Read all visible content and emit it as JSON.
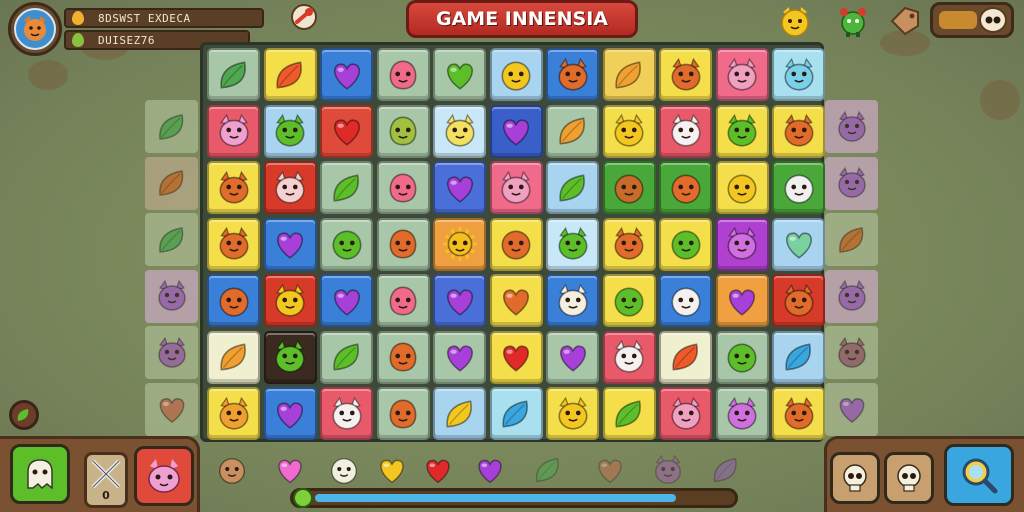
{
  "hud": {
    "stat1_text": "8DSWST EXDECA",
    "stat2_text": "DUISEZ76",
    "stat1_icon": "drop-icon",
    "stat2_icon": "leaf-icon",
    "title": "GAME INNENSIA",
    "sound_toggle_on": true
  },
  "colors": {
    "title_bg": "#c8362c",
    "accent_green": "#5cbf2a",
    "accent_blue": "#3aa6e0"
  },
  "board": {
    "rows": [
      [
        [
          "#a8c7a8",
          "leaf",
          "#4fa84f"
        ],
        [
          "#f4df4a",
          "leaf",
          "#ef5a2a"
        ],
        [
          "#3a7fd8",
          "heart",
          "#a740d8"
        ],
        [
          "#a8c7a8",
          "blob",
          "#f06a8a"
        ],
        [
          "#a8c7a8",
          "heart",
          "#5cbf2a"
        ],
        [
          "#a8d4f0",
          "face",
          "#f3c620"
        ],
        [
          "#3a7fd8",
          "cat",
          "#e06b2a"
        ],
        [
          "#f0d058",
          "leaf",
          "#f0a030"
        ],
        [
          "#f4df4a",
          "cat",
          "#e06b2a"
        ],
        [
          "#f06a8a",
          "cat",
          "#f0a0c0"
        ],
        [
          "#a8e0f0",
          "cat",
          "#7ad0e8"
        ]
      ],
      [
        [
          "#e85a6a",
          "cat",
          "#f0a0d0"
        ],
        [
          "#a8d4f0",
          "cat",
          "#5cbf2a"
        ],
        [
          "#e04a3a",
          "heart",
          "#e02a2a"
        ],
        [
          "#a8c7a8",
          "blob",
          "#a0c040"
        ],
        [
          "#c8e8f8",
          "cat",
          "#f4e060"
        ],
        [
          "#3a5fc8",
          "heart",
          "#a740d8"
        ],
        [
          "#a8c7a8",
          "leaf",
          "#f0a030"
        ],
        [
          "#f4df4a",
          "cat",
          "#f3c620"
        ],
        [
          "#e85a6a",
          "cat",
          "#f6f0f0"
        ],
        [
          "#f4df4a",
          "cat",
          "#5cbf2a"
        ],
        [
          "#f4df4a",
          "cat",
          "#e06b2a"
        ]
      ],
      [
        [
          "#f4df4a",
          "cat",
          "#e06b2a"
        ],
        [
          "#d83a2a",
          "cat",
          "#f4d0d0"
        ],
        [
          "#a8c7a8",
          "leaf",
          "#5cbf2a"
        ],
        [
          "#a8c7a8",
          "blob",
          "#f06a8a"
        ],
        [
          "#4a6fd8",
          "heart",
          "#a740d8"
        ],
        [
          "#f06a8a",
          "cat",
          "#f0a0c0"
        ],
        [
          "#a8d4f0",
          "leaf",
          "#5cbf2a"
        ],
        [
          "#4aa83a",
          "face",
          "#c86a2a"
        ],
        [
          "#4aa83a",
          "face",
          "#e06b2a"
        ],
        [
          "#f4df4a",
          "face",
          "#f3c620"
        ],
        [
          "#4aa83a",
          "face",
          "#f0f0f0"
        ]
      ],
      [
        [
          "#f4df4a",
          "cat",
          "#e06b2a"
        ],
        [
          "#3a7fd8",
          "heart",
          "#a740d8"
        ],
        [
          "#a8c7a8",
          "face",
          "#5cbf2a"
        ],
        [
          "#a8c7a8",
          "blob",
          "#e06b2a"
        ],
        [
          "#f0a040",
          "sun",
          "#f4c020"
        ],
        [
          "#f4df4a",
          "face",
          "#e06b2a"
        ],
        [
          "#c8e8f8",
          "cat",
          "#5cbf2a"
        ],
        [
          "#f4df4a",
          "cat",
          "#e06b2a"
        ],
        [
          "#f4df4a",
          "face",
          "#5cbf2a"
        ],
        [
          "#b040d0",
          "cat",
          "#d070e0"
        ],
        [
          "#a8d4f0",
          "heart",
          "#7ad0a0"
        ]
      ],
      [
        [
          "#3a7fd8",
          "face",
          "#e06b2a"
        ],
        [
          "#d83a2a",
          "cat",
          "#f3c620"
        ],
        [
          "#3a7fd8",
          "heart",
          "#a740d8"
        ],
        [
          "#a8c7a8",
          "blob",
          "#f06a8a"
        ],
        [
          "#4a6fd8",
          "heart",
          "#a740d8"
        ],
        [
          "#f4df4a",
          "heart",
          "#e06b2a"
        ],
        [
          "#3a7fd8",
          "cat",
          "#f4f0e0"
        ],
        [
          "#f4df4a",
          "face",
          "#5cbf2a"
        ],
        [
          "#3a7fd8",
          "face",
          "#f4f0f0"
        ],
        [
          "#f0a040",
          "heart",
          "#a740d8"
        ],
        [
          "#d83a2a",
          "cat",
          "#e06b2a"
        ]
      ],
      [
        [
          "#f0f0d0",
          "leaf",
          "#f0a030"
        ],
        [
          "#3a2a20",
          "cat",
          "#5cbf2a"
        ],
        [
          "#a8c7a8",
          "leaf",
          "#5cbf2a"
        ],
        [
          "#a8c7a8",
          "blob",
          "#e06b2a"
        ],
        [
          "#a8c7a8",
          "heart",
          "#a740d8"
        ],
        [
          "#f4df4a",
          "heart",
          "#e02a2a"
        ],
        [
          "#a8c7a8",
          "heart",
          "#a740d8"
        ],
        [
          "#e85a6a",
          "cat",
          "#f6f0f0"
        ],
        [
          "#f0f0d0",
          "leaf",
          "#ef5a2a"
        ],
        [
          "#a8c7a8",
          "face",
          "#5cbf2a"
        ],
        [
          "#a8d4f0",
          "leaf",
          "#3aa6e0"
        ]
      ],
      [
        [
          "#f4df4a",
          "cat",
          "#f0a030"
        ],
        [
          "#3a7fd8",
          "heart",
          "#a740d8"
        ],
        [
          "#e85a6a",
          "cat",
          "#f6f0f0"
        ],
        [
          "#a8c7a8",
          "blob",
          "#e06b2a"
        ],
        [
          "#a8d4f0",
          "leaf",
          "#f3c620"
        ],
        [
          "#a8e0f0",
          "leaf",
          "#3aa6e0"
        ],
        [
          "#f4df4a",
          "cat",
          "#f3c620"
        ],
        [
          "#f4df4a",
          "leaf",
          "#5cbf2a"
        ],
        [
          "#e85a6a",
          "cat",
          "#f0a0c0"
        ],
        [
          "#a8c7a8",
          "cat",
          "#d070e0"
        ],
        [
          "#f4df4a",
          "cat",
          "#e06b2a"
        ]
      ]
    ]
  },
  "tray": [
    [
      "face",
      "#c89060"
    ],
    [
      "heart",
      "#f06ad0"
    ],
    [
      "face",
      "#f0f0e0"
    ],
    [
      "heart",
      "#f3c620"
    ],
    [
      "heart",
      "#e02a2a"
    ],
    [
      "heart",
      "#a740d8"
    ],
    [
      "leaf",
      "#4fa84f"
    ],
    [
      "heart",
      "#c07050"
    ],
    [
      "cat",
      "#a060b0"
    ],
    [
      "leaf",
      "#9060b0"
    ]
  ],
  "controls": {
    "counter": "0",
    "progress": 0.88
  }
}
